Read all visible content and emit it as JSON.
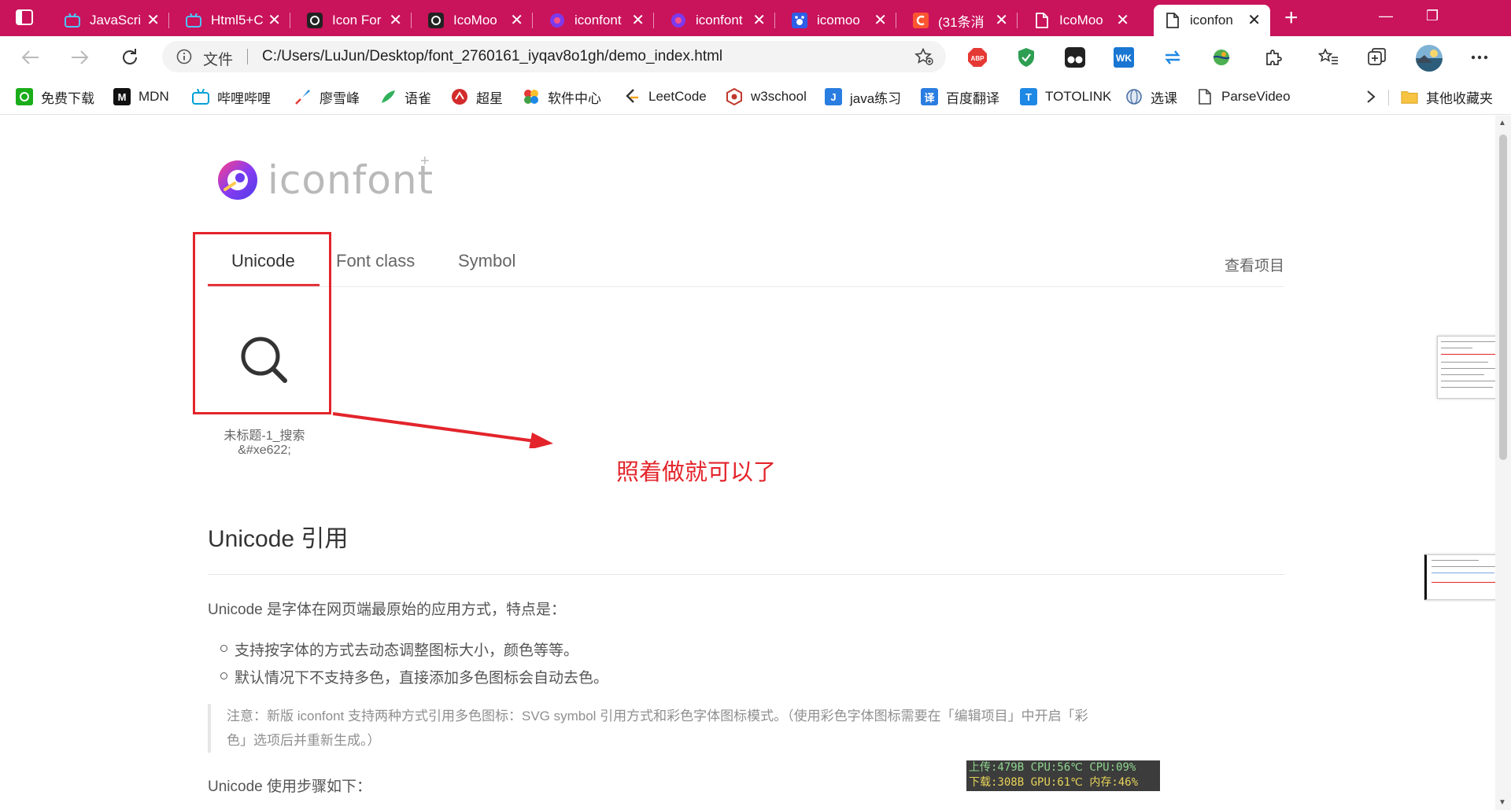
{
  "browser": {
    "tabs": [
      {
        "title": "JavaScri",
        "icon": "bilibili-icon"
      },
      {
        "title": "Html5+C",
        "icon": "bilibili-icon"
      },
      {
        "title": "Icon For",
        "icon": "icomoon-icon"
      },
      {
        "title": "IcoMoo",
        "icon": "icomoon-icon"
      },
      {
        "title": "iconfont",
        "icon": "iconfont-icon"
      },
      {
        "title": "iconfont",
        "icon": "iconfont-icon"
      },
      {
        "title": "icomoo",
        "icon": "baidu-icon"
      },
      {
        "title": "(31条消",
        "icon": "csdn-icon"
      },
      {
        "title": "IcoMoo",
        "icon": "page-icon"
      },
      {
        "title": "iconfon",
        "icon": "page-icon",
        "active": true
      }
    ],
    "tab_close_glyph": "✕",
    "new_tab_glyph": "+",
    "window": {
      "minimize": "—",
      "restore": "❐"
    },
    "address": {
      "label": "文件",
      "url": "C:/Users/LuJun/Desktop/font_2760161_iyqav8o1gh/demo_index.html"
    },
    "extensions": {
      "abp_label": "ABP",
      "wk_label": "WK"
    },
    "accent_color": "#c9135b"
  },
  "bookmarks": [
    {
      "label": "免费下载",
      "icon": "download-icon",
      "color": "#1aad19"
    },
    {
      "label": "MDN",
      "icon": "mdn-icon",
      "color": "#111111"
    },
    {
      "label": "哔哩哔哩",
      "icon": "bilibili-icon",
      "color": "#00a1d6"
    },
    {
      "label": "廖雪峰",
      "icon": "rocket-icon",
      "color": "#2a8fe0"
    },
    {
      "label": "语雀",
      "icon": "yuque-icon",
      "color": "#31b15a"
    },
    {
      "label": "超星",
      "icon": "chaoxing-icon",
      "color": "#d22b2b"
    },
    {
      "label": "软件中心",
      "icon": "software-center-icon",
      "color": "#e45b9c"
    },
    {
      "label": "LeetCode",
      "icon": "leetcode-icon",
      "color": "#333333"
    },
    {
      "label": "w3school",
      "icon": "w3school-icon",
      "color": "#c0392b"
    },
    {
      "label": "java练习",
      "icon": "java-icon",
      "color": "#2a7de1"
    },
    {
      "label": "百度翻译",
      "icon": "translate-icon",
      "color": "#2a7de1"
    },
    {
      "label": "TOTOLINK",
      "icon": "totolink-icon",
      "color": "#1e88e5"
    },
    {
      "label": "选课",
      "icon": "globe-icon",
      "color": "#4a6fa5"
    },
    {
      "label": "ParseVideo",
      "icon": "page-icon",
      "color": "#555555"
    }
  ],
  "bookmarks_more": "其他收藏夹",
  "bookmark_glyphs": {
    "mdn": "M",
    "translate": "译",
    "totolink": "T",
    "java": "J"
  },
  "page": {
    "logo_text": "iconfont",
    "logo_plus": "+",
    "tabs": [
      "Unicode",
      "Font class",
      "Symbol"
    ],
    "view_project": "查看项目",
    "icon_item": {
      "name": "未标题-1_搜索",
      "code": "&#xe622;"
    },
    "annotation": "照着做就可以了",
    "section_title": "Unicode 引用",
    "intro": "Unicode 是字体在网页端最原始的应用方式，特点是：",
    "bullets": [
      "支持按字体的方式去动态调整图标大小，颜色等等。",
      "默认情况下不支持多色，直接添加多色图标会自动去色。"
    ],
    "note": "注意：新版 iconfont 支持两种方式引用多色图标：SVG symbol 引用方式和彩色字体图标模式。（使用彩色字体图标需要在「编辑项目」中开启「彩色」选项后并重新生成。）",
    "steps_intro": "Unicode 使用步骤如下："
  },
  "net_monitor": {
    "upload": "上传:479B",
    "cpu_temp": "CPU:56℃",
    "cpu_load": "CPU:09%",
    "download": "下载:308B",
    "gpu_temp": "GPU:61℃",
    "memory": "内存:46%"
  },
  "colors": {
    "annotation_red": "#e3242b",
    "tab_underline": "#e5343b"
  }
}
